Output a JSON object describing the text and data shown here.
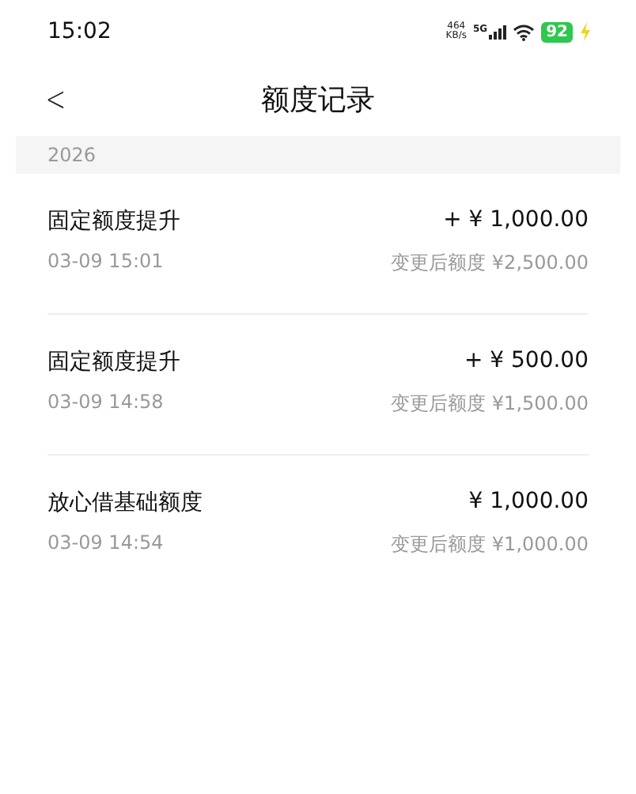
{
  "status_bar": {
    "time": "15:02",
    "speed": "464",
    "speed_unit": "KB/s",
    "network": "5G",
    "battery": "92"
  },
  "header": {
    "back": "<",
    "title": "额度记录"
  },
  "year": "2026",
  "records": [
    {
      "title": "固定额度提升",
      "amount": "+ ¥ 1,000.00",
      "time": "03-09 15:01",
      "balance": "变更后额度 ¥2,500.00"
    },
    {
      "title": "固定额度提升",
      "amount": "+ ¥ 500.00",
      "time": "03-09 14:58",
      "balance": "变更后额度 ¥1,500.00"
    },
    {
      "title": "放心借基础额度",
      "amount": "¥ 1,000.00",
      "time": "03-09 14:54",
      "balance": "变更后额度 ¥1,000.00"
    }
  ]
}
